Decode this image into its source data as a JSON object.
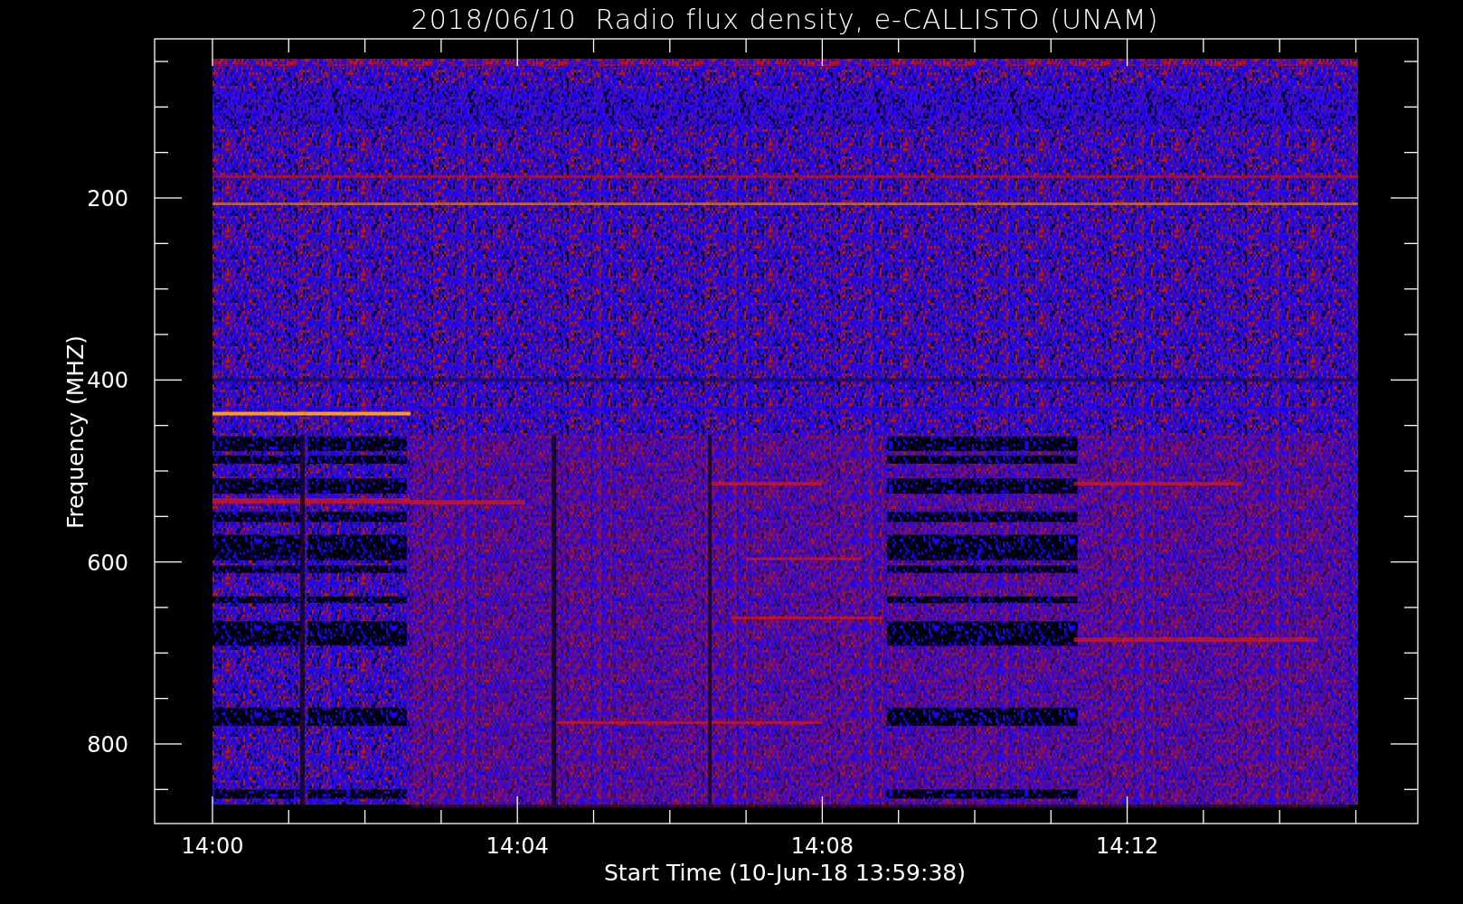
{
  "title": "2018/06/10  Radio flux density, e-CALLISTO (UNAM)",
  "y_axis": {
    "label": "Frequency (MHZ)",
    "ticks": [
      "200",
      "400",
      "600",
      "800"
    ]
  },
  "x_axis": {
    "label": "Start Time (10-Jun-18 13:59:38)",
    "ticks": [
      "14:00",
      "14:04",
      "14:08",
      "14:12"
    ]
  }
}
